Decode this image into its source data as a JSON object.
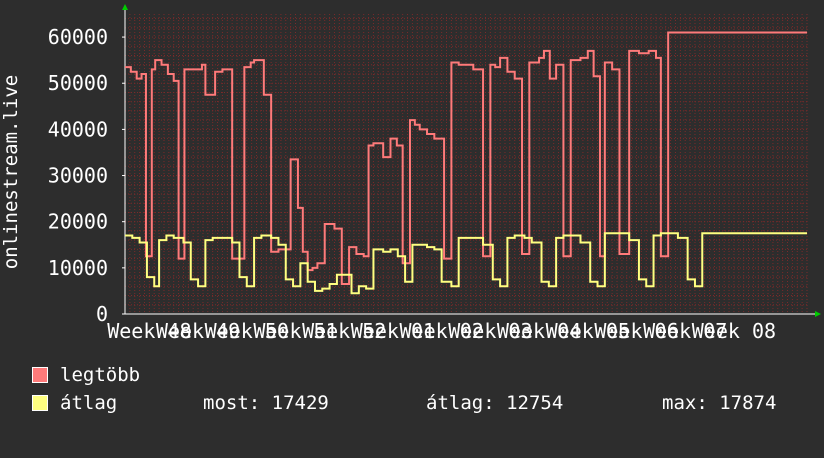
{
  "chart_data": {
    "type": "line",
    "ylabel": "onlinestream.live",
    "ylim": [
      0,
      65000
    ],
    "yticks": [
      0,
      10000,
      20000,
      30000,
      40000,
      50000,
      60000
    ],
    "ytick_labels": [
      "0",
      "10000",
      "20000",
      "30000",
      "40000",
      "50000",
      "60000"
    ],
    "xlim": [
      0,
      14
    ],
    "xticks": [
      0.5,
      1.5,
      2.5,
      3.5,
      4.5,
      5.5,
      6.5,
      7.5,
      8.5,
      9.5,
      10.5,
      11.5,
      12.5,
      13.5
    ],
    "xtick_labels": [
      "Week 48",
      "Week 49",
      "Week 50",
      "Week 51",
      "Week 52",
      "Week 01",
      "Week 02",
      "Week 03",
      "Week 04",
      "Week 05",
      "Week 06",
      "Week 07",
      "Week 08",
      ""
    ],
    "grid": true,
    "background": "#2d2d2d",
    "grid_color": "#7a2a2a",
    "series": [
      {
        "name": "legtöbb",
        "color": "#ff7a7a",
        "x": [
          0,
          0.12,
          0.24,
          0.34,
          0.43,
          0.55,
          0.62,
          0.75,
          0.88,
          1.0,
          1.1,
          1.22,
          1.35,
          1.45,
          1.58,
          1.65,
          1.85,
          2.0,
          2.2,
          2.45,
          2.58,
          2.65,
          2.85,
          3.0,
          3.15,
          3.4,
          3.55,
          3.65,
          3.75,
          3.85,
          3.95,
          4.1,
          4.3,
          4.45,
          4.6,
          4.75,
          4.9,
          5.0,
          5.1,
          5.3,
          5.45,
          5.58,
          5.7,
          5.85,
          5.95,
          6.05,
          6.2,
          6.35,
          6.55,
          6.7,
          6.85,
          7.0,
          7.15,
          7.35,
          7.5,
          7.6,
          7.7,
          7.85,
          8.0,
          8.15,
          8.3,
          8.5,
          8.6,
          8.72,
          8.85,
          9.0,
          9.15,
          9.35,
          9.5,
          9.62,
          9.75,
          9.85,
          10.0,
          10.15,
          10.35,
          10.55,
          10.65,
          10.75,
          10.9,
          11.0,
          11.15,
          11.35,
          11.5,
          11.62,
          11.72,
          11.85,
          12.0,
          12.1,
          12.3,
          12.45,
          12.55,
          12.7,
          12.85,
          13.0,
          13.12,
          13.35,
          13.5,
          13.62,
          13.75,
          13.9,
          14.0
        ],
        "values": [
          53500,
          52500,
          51000,
          52000,
          12500,
          53000,
          55000,
          54000,
          52000,
          50500,
          12000,
          53000,
          53000,
          53000,
          54000,
          47500,
          52500,
          53000,
          12000,
          53500,
          54500,
          55000,
          47500,
          13500,
          14000,
          33500,
          23000,
          13500,
          9500,
          10000,
          11000,
          19500,
          18500,
          6500,
          14500,
          13000,
          12500,
          36500,
          37000,
          34000,
          38000,
          36500,
          11000,
          42000,
          41000,
          40000,
          39000,
          38000,
          12000,
          54500,
          54000,
          54000,
          53000,
          12500,
          54000,
          53500,
          55500,
          52500,
          51000,
          13000,
          54500,
          55500,
          57000,
          51000,
          54000,
          12500,
          55000,
          55500,
          57000,
          51500,
          12500,
          54500,
          53000,
          13000,
          57000,
          56500,
          56500,
          57000,
          55500,
          12500,
          61000,
          61000,
          61000,
          61000,
          61000,
          61000,
          61000,
          61000,
          61000,
          61000,
          61000,
          61000,
          61000,
          61000,
          61000,
          61000,
          61000,
          61000,
          61000,
          61000,
          61000
        ]
      },
      {
        "name": "átlag",
        "color": "#ffff80",
        "x": [
          0,
          0.15,
          0.3,
          0.45,
          0.6,
          0.7,
          0.85,
          1.0,
          1.2,
          1.35,
          1.5,
          1.65,
          1.8,
          2.0,
          2.2,
          2.35,
          2.5,
          2.65,
          2.8,
          3.0,
          3.15,
          3.3,
          3.45,
          3.6,
          3.75,
          3.9,
          4.05,
          4.2,
          4.35,
          4.5,
          4.65,
          4.8,
          4.95,
          5.1,
          5.3,
          5.45,
          5.6,
          5.75,
          5.9,
          6.05,
          6.2,
          6.35,
          6.5,
          6.7,
          6.85,
          7.0,
          7.2,
          7.35,
          7.55,
          7.7,
          7.85,
          8.0,
          8.2,
          8.35,
          8.55,
          8.7,
          8.85,
          9.0,
          9.2,
          9.35,
          9.55,
          9.7,
          9.85,
          10.0,
          10.2,
          10.35,
          10.55,
          10.7,
          10.85,
          11.0,
          11.2,
          11.35,
          11.55,
          11.7,
          11.85,
          12.0,
          12.2,
          12.35,
          12.55,
          12.7,
          12.85,
          13.0,
          13.2,
          13.35,
          13.55,
          13.7,
          13.85,
          14.0
        ],
        "values": [
          17000,
          16500,
          15500,
          8000,
          6000,
          16000,
          17000,
          16500,
          15500,
          7500,
          6000,
          16000,
          16500,
          16500,
          15500,
          8000,
          6000,
          16500,
          17000,
          16500,
          15000,
          7500,
          6000,
          11000,
          7000,
          5000,
          5500,
          6500,
          8500,
          8500,
          4500,
          6000,
          5500,
          14000,
          13500,
          14000,
          12500,
          7000,
          15000,
          15000,
          14500,
          14000,
          7000,
          6000,
          16500,
          16500,
          16500,
          15000,
          7500,
          6000,
          16500,
          17000,
          16500,
          15500,
          7000,
          6000,
          16500,
          17000,
          17000,
          15500,
          7000,
          6000,
          17500,
          17500,
          17500,
          16000,
          7500,
          6000,
          17000,
          17500,
          17500,
          16500,
          7500,
          6000,
          17500,
          17500,
          17500,
          17500,
          17500,
          17500,
          17500,
          17500,
          17500,
          17500,
          17500,
          17500,
          17500,
          17500
        ]
      }
    ]
  },
  "legend": [
    {
      "label": "legtöbb",
      "color": "#ff7a7a"
    },
    {
      "label": "átlag",
      "color": "#ffff80"
    }
  ],
  "stats": {
    "most": "most: 17429",
    "atlag": "átlag: 12754",
    "max": "max: 17874"
  }
}
